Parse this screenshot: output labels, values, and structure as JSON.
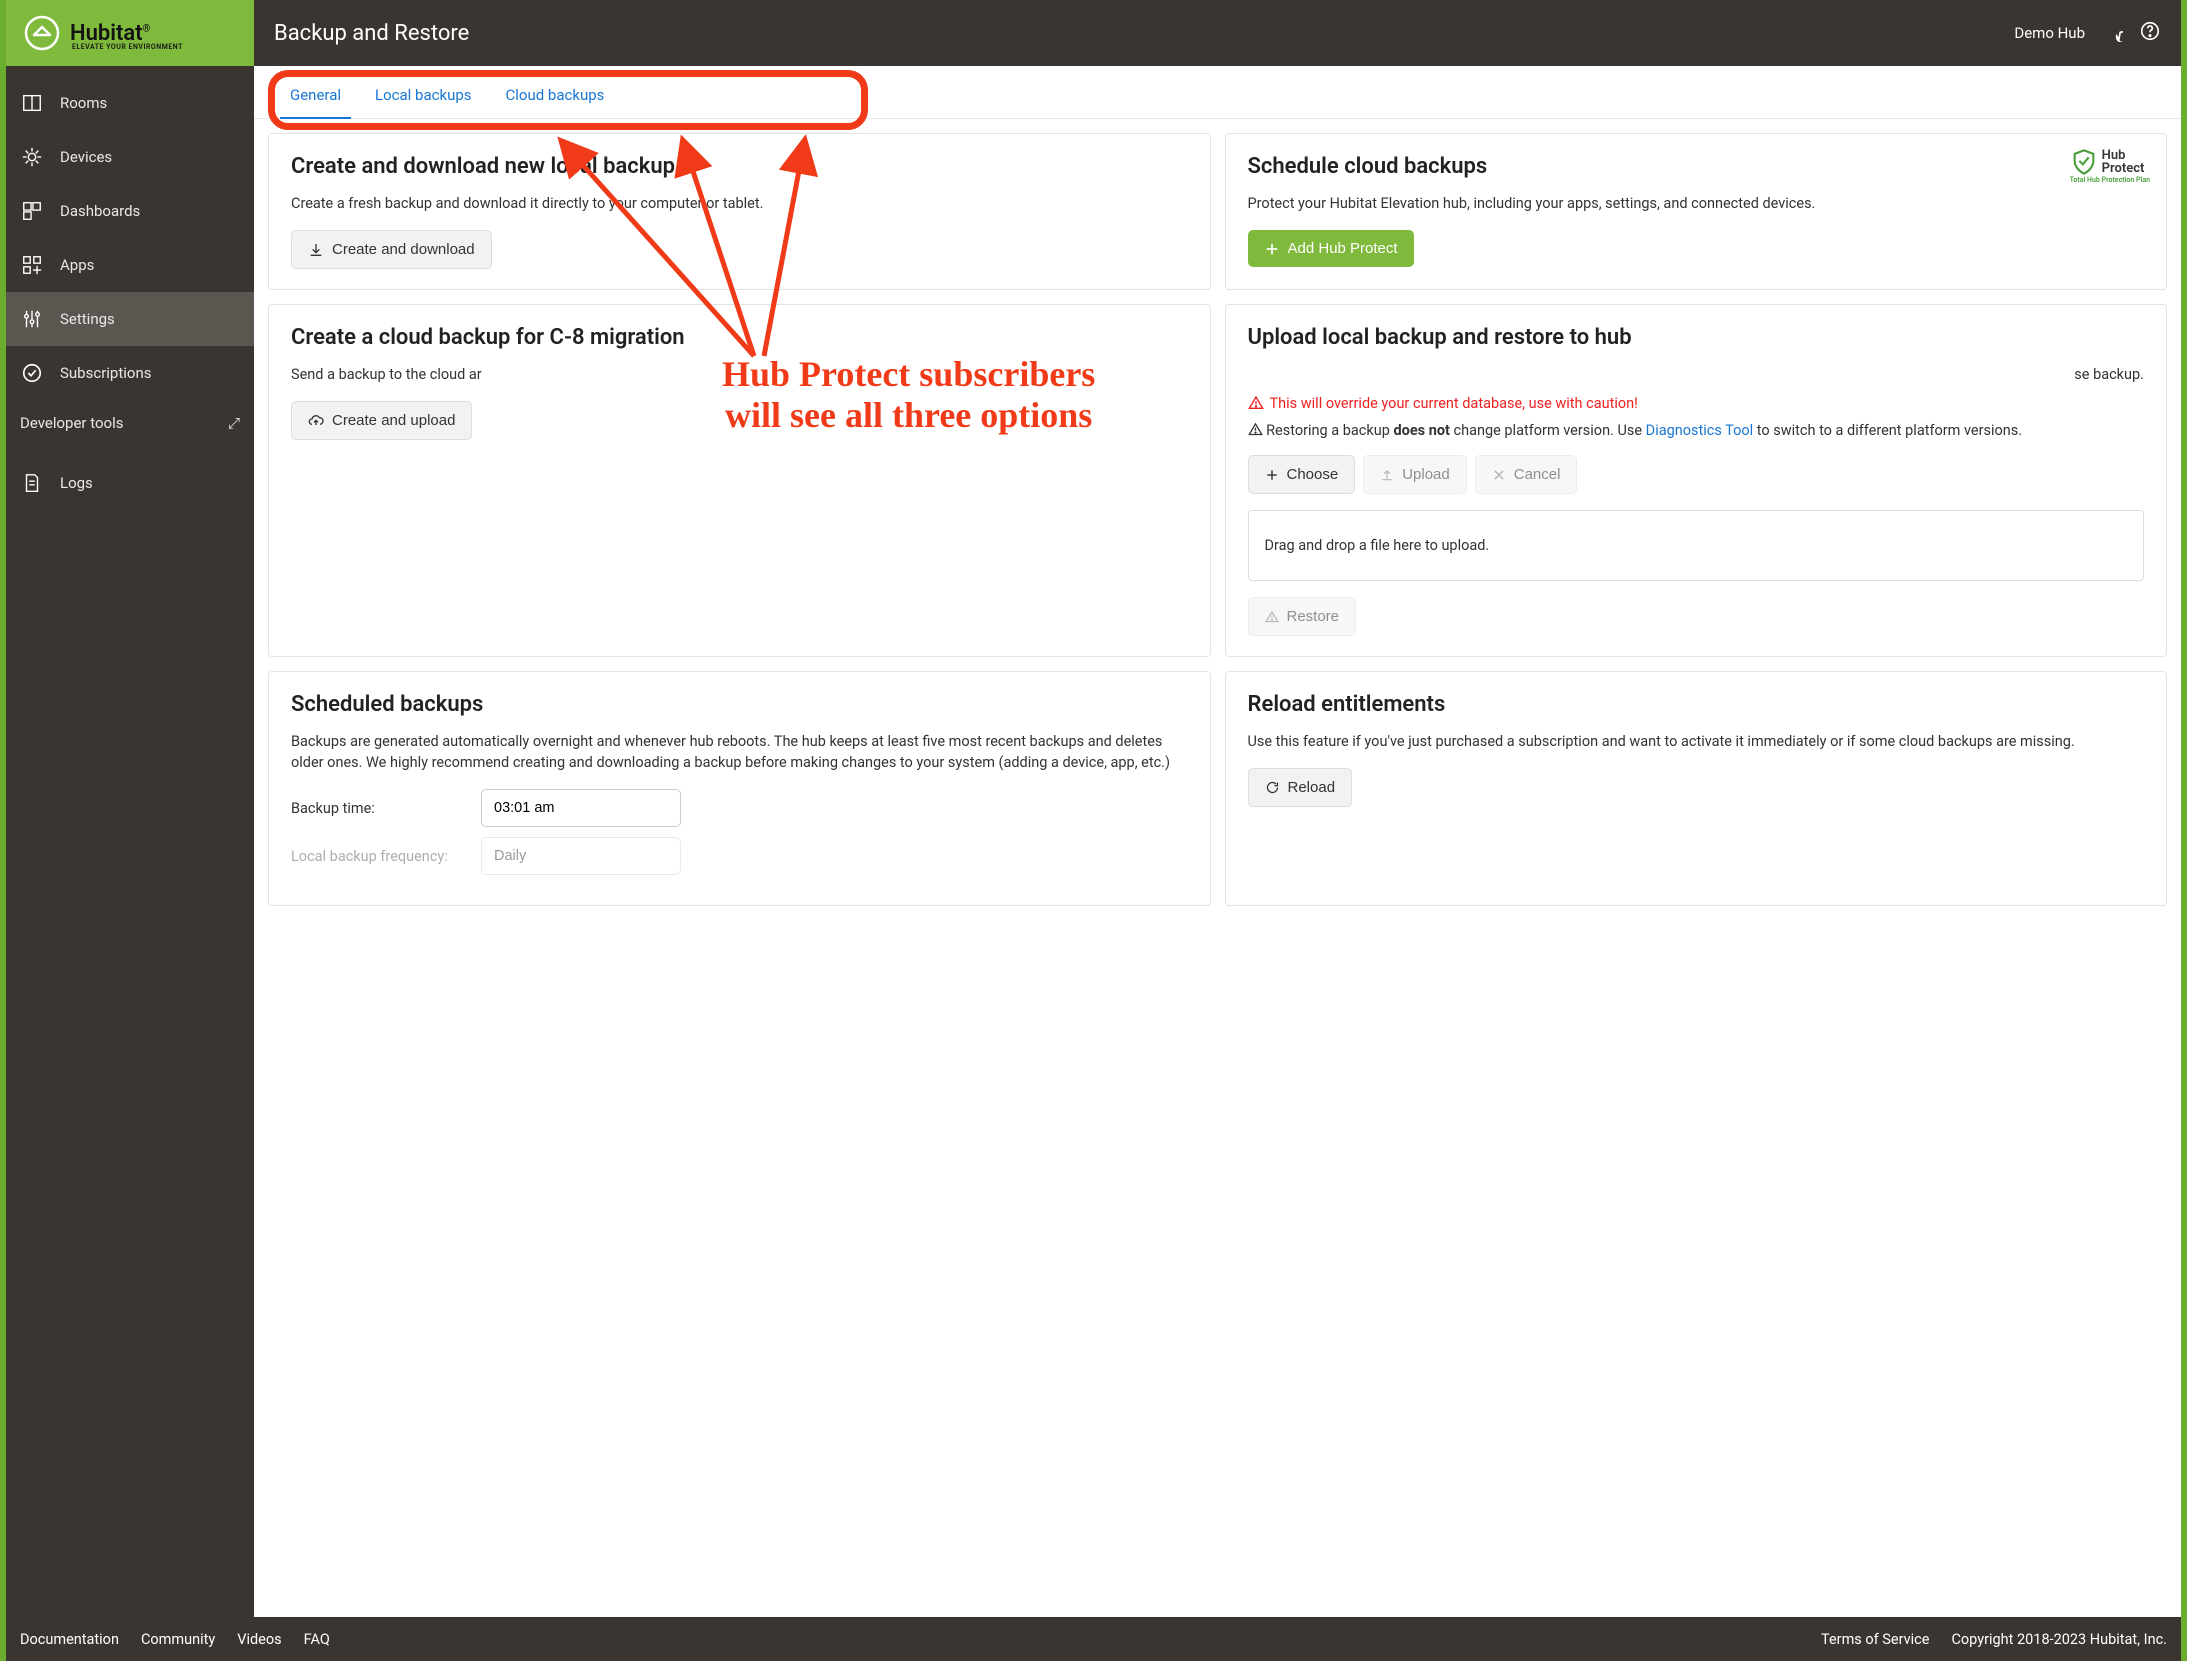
{
  "brand": {
    "name": "Hubitat",
    "tagline": "ELEVATE YOUR ENVIRONMENT",
    "reg": "®"
  },
  "sidebar": {
    "items": [
      {
        "label": "Rooms"
      },
      {
        "label": "Devices"
      },
      {
        "label": "Dashboards"
      },
      {
        "label": "Apps"
      },
      {
        "label": "Settings"
      },
      {
        "label": "Subscriptions"
      },
      {
        "label": "Logs"
      }
    ],
    "dev_tools": "Developer tools"
  },
  "header": {
    "title": "Backup and Restore",
    "hub_name": "Demo Hub"
  },
  "tabs": [
    {
      "label": "General"
    },
    {
      "label": "Local backups"
    },
    {
      "label": "Cloud backups"
    }
  ],
  "annotation": {
    "line1": "Hub Protect subscribers",
    "line2": "will see all three options"
  },
  "cards": {
    "create_download": {
      "title": "Create and download new local backup",
      "desc": "Create a fresh backup and download it directly to your computer or tablet.",
      "btn": "Create and download"
    },
    "schedule_cloud": {
      "title": "Schedule cloud backups",
      "desc": "Protect your Hubitat Elevation hub, including your apps, settings, and connected devices.",
      "btn": "Add Hub Protect",
      "logo": {
        "line1": "Hub",
        "line2": "Protect",
        "tag": "Total Hub Protection Plan"
      }
    },
    "create_cloud": {
      "title": "Create a cloud backup for C-8 migration",
      "desc_a": "Send a backup to the cloud ar",
      "desc_b": "se backup.",
      "btn": "Create and upload"
    },
    "upload_restore": {
      "title": "Upload local backup and restore to hub",
      "warn": "This will override your current database, use with caution!",
      "info_a": "Restoring a backup ",
      "info_bold": "does not",
      "info_b": " change platform version. Use ",
      "link": "Diagnostics Tool",
      "info_c": " to switch to a different platform versions.",
      "choose": "Choose",
      "upload": "Upload",
      "cancel": "Cancel",
      "dropzone": "Drag and drop a file here to upload.",
      "restore": "Restore"
    },
    "scheduled": {
      "title": "Scheduled backups",
      "desc": "Backups are generated automatically overnight and whenever hub reboots. The hub keeps at least five most recent backups and deletes older ones. We highly recommend creating and downloading a backup before making changes to your system (adding a device, app, etc.)",
      "time_label": "Backup time:",
      "time_value": "03:01 am",
      "freq_label": "Local backup frequency:",
      "freq_value": "Daily"
    },
    "reload": {
      "title": "Reload entitlements",
      "desc": "Use this feature if you've just purchased a subscription and want to activate it immediately or if some cloud backups are missing.",
      "btn": "Reload"
    }
  },
  "footer": {
    "left": [
      "Documentation",
      "Community",
      "Videos",
      "FAQ"
    ],
    "right": [
      "Terms of Service",
      "Copyright 2018-2023 Hubitat, Inc."
    ]
  }
}
